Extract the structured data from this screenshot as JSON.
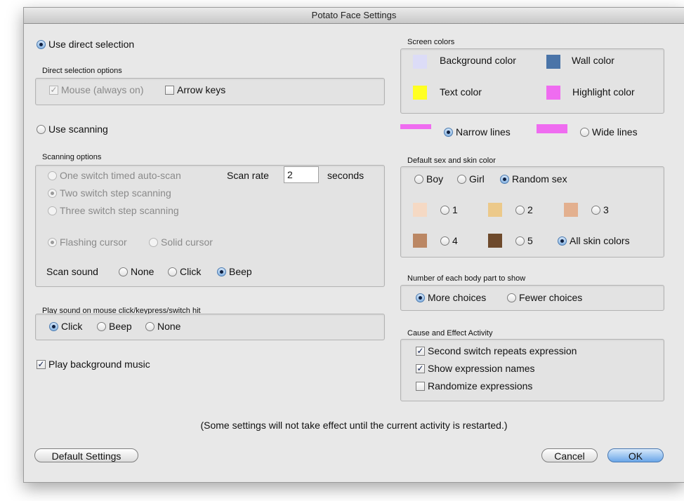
{
  "window": {
    "title": "Potato Face Settings"
  },
  "selection": {
    "direct_label": "Use direct selection",
    "direct_options_title": "Direct selection options",
    "mouse_label": "Mouse (always on)",
    "arrow_keys_label": "Arrow keys",
    "scanning_label": "Use scanning"
  },
  "scanning": {
    "title": "Scanning options",
    "one_switch": "One switch timed auto-scan",
    "scan_rate_label": "Scan rate",
    "scan_rate_value": "2",
    "seconds_label": "seconds",
    "two_switch": "Two switch step scanning",
    "three_switch": "Three switch step scanning",
    "flashing_cursor": "Flashing cursor",
    "solid_cursor": "Solid cursor",
    "scan_sound_label": "Scan sound",
    "sound_none": "None",
    "sound_click": "Click",
    "sound_beep": "Beep"
  },
  "mouse_sound": {
    "title": "Play sound on mouse click/keypress/switch hit",
    "click": "Click",
    "beep": "Beep",
    "none": "None"
  },
  "music": {
    "label": "Play background music"
  },
  "screen_colors": {
    "title": "Screen colors",
    "background_label": "Background color",
    "wall_label": "Wall color",
    "text_label": "Text color",
    "highlight_label": "Highlight color",
    "background_color": "#dcdcf7",
    "wall_color": "#4a74a8",
    "text_color": "#ffff22",
    "highlight_color": "#ef6cf0"
  },
  "lines": {
    "narrow": "Narrow lines",
    "wide": "Wide lines",
    "swatch_color": "#ef6cf0"
  },
  "sex_skin": {
    "title": "Default sex and skin color",
    "boy": "Boy",
    "girl": "Girl",
    "random_sex": "Random sex",
    "skin1": "1",
    "skin2": "2",
    "skin3": "3",
    "skin4": "4",
    "skin5": "5",
    "all_skin": "All skin colors",
    "colors": [
      "#f5d9c4",
      "#ecc98a",
      "#e3b08f",
      "#bb8764",
      "#6e4a2c"
    ]
  },
  "body_parts": {
    "title": "Number of each body part to show",
    "more": "More choices",
    "fewer": "Fewer choices"
  },
  "cause_effect": {
    "title": "Cause and Effect Activity",
    "repeat": "Second switch repeats expression",
    "names": "Show expression names",
    "randomize": "Randomize expressions"
  },
  "footer": {
    "note": "(Some settings will not take effect until the current activity is restarted.)",
    "default_button": "Default Settings",
    "cancel_button": "Cancel",
    "ok_button": "OK"
  }
}
